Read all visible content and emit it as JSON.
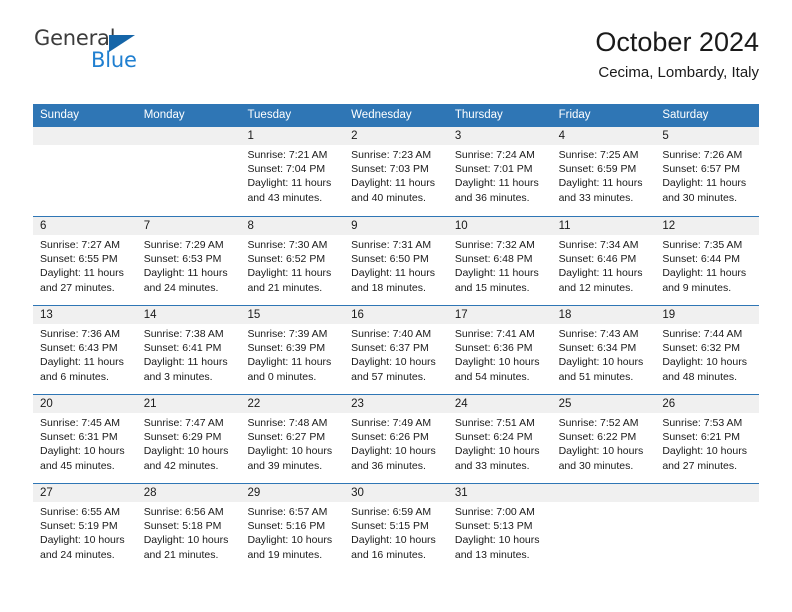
{
  "logo": {
    "word_top": "General",
    "word_bottom": "Blue",
    "triangle_icon": "blue-triangle-icon",
    "accent_color": "#1f7fd0",
    "triangle_color": "#1565a8"
  },
  "header": {
    "title": "October 2024",
    "subtitle": "Cecima, Lombardy, Italy"
  },
  "calendar": {
    "header_bg": "#2f76b5",
    "header_text_color": "#ffffff",
    "day_strip_bg": "#f0f0f0",
    "weekdays": [
      "Sunday",
      "Monday",
      "Tuesday",
      "Wednesday",
      "Thursday",
      "Friday",
      "Saturday"
    ],
    "weeks": [
      [
        {
          "day": "",
          "lines": []
        },
        {
          "day": "",
          "lines": []
        },
        {
          "day": "1",
          "lines": [
            "Sunrise: 7:21 AM",
            "Sunset: 7:04 PM",
            "Daylight: 11 hours",
            "and 43 minutes."
          ]
        },
        {
          "day": "2",
          "lines": [
            "Sunrise: 7:23 AM",
            "Sunset: 7:03 PM",
            "Daylight: 11 hours",
            "and 40 minutes."
          ]
        },
        {
          "day": "3",
          "lines": [
            "Sunrise: 7:24 AM",
            "Sunset: 7:01 PM",
            "Daylight: 11 hours",
            "and 36 minutes."
          ]
        },
        {
          "day": "4",
          "lines": [
            "Sunrise: 7:25 AM",
            "Sunset: 6:59 PM",
            "Daylight: 11 hours",
            "and 33 minutes."
          ]
        },
        {
          "day": "5",
          "lines": [
            "Sunrise: 7:26 AM",
            "Sunset: 6:57 PM",
            "Daylight: 11 hours",
            "and 30 minutes."
          ]
        }
      ],
      [
        {
          "day": "6",
          "lines": [
            "Sunrise: 7:27 AM",
            "Sunset: 6:55 PM",
            "Daylight: 11 hours",
            "and 27 minutes."
          ]
        },
        {
          "day": "7",
          "lines": [
            "Sunrise: 7:29 AM",
            "Sunset: 6:53 PM",
            "Daylight: 11 hours",
            "and 24 minutes."
          ]
        },
        {
          "day": "8",
          "lines": [
            "Sunrise: 7:30 AM",
            "Sunset: 6:52 PM",
            "Daylight: 11 hours",
            "and 21 minutes."
          ]
        },
        {
          "day": "9",
          "lines": [
            "Sunrise: 7:31 AM",
            "Sunset: 6:50 PM",
            "Daylight: 11 hours",
            "and 18 minutes."
          ]
        },
        {
          "day": "10",
          "lines": [
            "Sunrise: 7:32 AM",
            "Sunset: 6:48 PM",
            "Daylight: 11 hours",
            "and 15 minutes."
          ]
        },
        {
          "day": "11",
          "lines": [
            "Sunrise: 7:34 AM",
            "Sunset: 6:46 PM",
            "Daylight: 11 hours",
            "and 12 minutes."
          ]
        },
        {
          "day": "12",
          "lines": [
            "Sunrise: 7:35 AM",
            "Sunset: 6:44 PM",
            "Daylight: 11 hours",
            "and 9 minutes."
          ]
        }
      ],
      [
        {
          "day": "13",
          "lines": [
            "Sunrise: 7:36 AM",
            "Sunset: 6:43 PM",
            "Daylight: 11 hours",
            "and 6 minutes."
          ]
        },
        {
          "day": "14",
          "lines": [
            "Sunrise: 7:38 AM",
            "Sunset: 6:41 PM",
            "Daylight: 11 hours",
            "and 3 minutes."
          ]
        },
        {
          "day": "15",
          "lines": [
            "Sunrise: 7:39 AM",
            "Sunset: 6:39 PM",
            "Daylight: 11 hours",
            "and 0 minutes."
          ]
        },
        {
          "day": "16",
          "lines": [
            "Sunrise: 7:40 AM",
            "Sunset: 6:37 PM",
            "Daylight: 10 hours",
            "and 57 minutes."
          ]
        },
        {
          "day": "17",
          "lines": [
            "Sunrise: 7:41 AM",
            "Sunset: 6:36 PM",
            "Daylight: 10 hours",
            "and 54 minutes."
          ]
        },
        {
          "day": "18",
          "lines": [
            "Sunrise: 7:43 AM",
            "Sunset: 6:34 PM",
            "Daylight: 10 hours",
            "and 51 minutes."
          ]
        },
        {
          "day": "19",
          "lines": [
            "Sunrise: 7:44 AM",
            "Sunset: 6:32 PM",
            "Daylight: 10 hours",
            "and 48 minutes."
          ]
        }
      ],
      [
        {
          "day": "20",
          "lines": [
            "Sunrise: 7:45 AM",
            "Sunset: 6:31 PM",
            "Daylight: 10 hours",
            "and 45 minutes."
          ]
        },
        {
          "day": "21",
          "lines": [
            "Sunrise: 7:47 AM",
            "Sunset: 6:29 PM",
            "Daylight: 10 hours",
            "and 42 minutes."
          ]
        },
        {
          "day": "22",
          "lines": [
            "Sunrise: 7:48 AM",
            "Sunset: 6:27 PM",
            "Daylight: 10 hours",
            "and 39 minutes."
          ]
        },
        {
          "day": "23",
          "lines": [
            "Sunrise: 7:49 AM",
            "Sunset: 6:26 PM",
            "Daylight: 10 hours",
            "and 36 minutes."
          ]
        },
        {
          "day": "24",
          "lines": [
            "Sunrise: 7:51 AM",
            "Sunset: 6:24 PM",
            "Daylight: 10 hours",
            "and 33 minutes."
          ]
        },
        {
          "day": "25",
          "lines": [
            "Sunrise: 7:52 AM",
            "Sunset: 6:22 PM",
            "Daylight: 10 hours",
            "and 30 minutes."
          ]
        },
        {
          "day": "26",
          "lines": [
            "Sunrise: 7:53 AM",
            "Sunset: 6:21 PM",
            "Daylight: 10 hours",
            "and 27 minutes."
          ]
        }
      ],
      [
        {
          "day": "27",
          "lines": [
            "Sunrise: 6:55 AM",
            "Sunset: 5:19 PM",
            "Daylight: 10 hours",
            "and 24 minutes."
          ]
        },
        {
          "day": "28",
          "lines": [
            "Sunrise: 6:56 AM",
            "Sunset: 5:18 PM",
            "Daylight: 10 hours",
            "and 21 minutes."
          ]
        },
        {
          "day": "29",
          "lines": [
            "Sunrise: 6:57 AM",
            "Sunset: 5:16 PM",
            "Daylight: 10 hours",
            "and 19 minutes."
          ]
        },
        {
          "day": "30",
          "lines": [
            "Sunrise: 6:59 AM",
            "Sunset: 5:15 PM",
            "Daylight: 10 hours",
            "and 16 minutes."
          ]
        },
        {
          "day": "31",
          "lines": [
            "Sunrise: 7:00 AM",
            "Sunset: 5:13 PM",
            "Daylight: 10 hours",
            "and 13 minutes."
          ]
        },
        {
          "day": "",
          "lines": []
        },
        {
          "day": "",
          "lines": []
        }
      ]
    ]
  }
}
